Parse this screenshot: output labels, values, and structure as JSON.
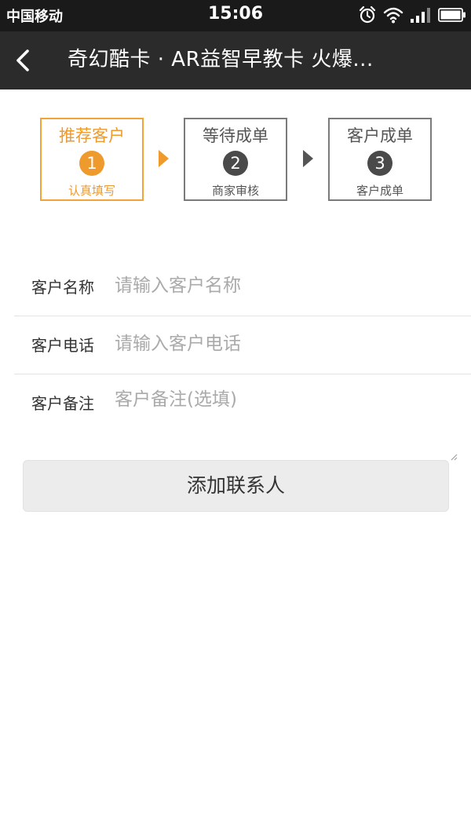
{
  "status_bar": {
    "carrier": "中国移动",
    "time": "15:06",
    "icons": [
      "alarm-icon",
      "wifi-icon",
      "signal-icon",
      "battery-icon"
    ]
  },
  "nav": {
    "back_icon": "chevron-left-icon",
    "title": "奇幻酷卡 · AR益智早教卡 火爆..."
  },
  "steps": [
    {
      "title": "推荐客户",
      "number": "1",
      "subtitle": "认真填写",
      "active": true
    },
    {
      "title": "等待成单",
      "number": "2",
      "subtitle": "商家审核",
      "active": false
    },
    {
      "title": "客户成单",
      "number": "3",
      "subtitle": "客户成单",
      "active": false
    }
  ],
  "form": {
    "name": {
      "label": "客户名称",
      "placeholder": "请输入客户名称",
      "value": ""
    },
    "phone": {
      "label": "客户电话",
      "placeholder": "请输入客户电话",
      "value": ""
    },
    "note": {
      "label": "客户备注",
      "placeholder": "客户备注(选填)",
      "value": ""
    }
  },
  "add_button": {
    "label": "添加联系人"
  },
  "colors": {
    "accent": "#ee9a2c",
    "statusbar": "#1a1a1a",
    "navbar": "#2b2b2b",
    "inactive_step": "#4a4a4a",
    "button_bg": "#ececec"
  }
}
